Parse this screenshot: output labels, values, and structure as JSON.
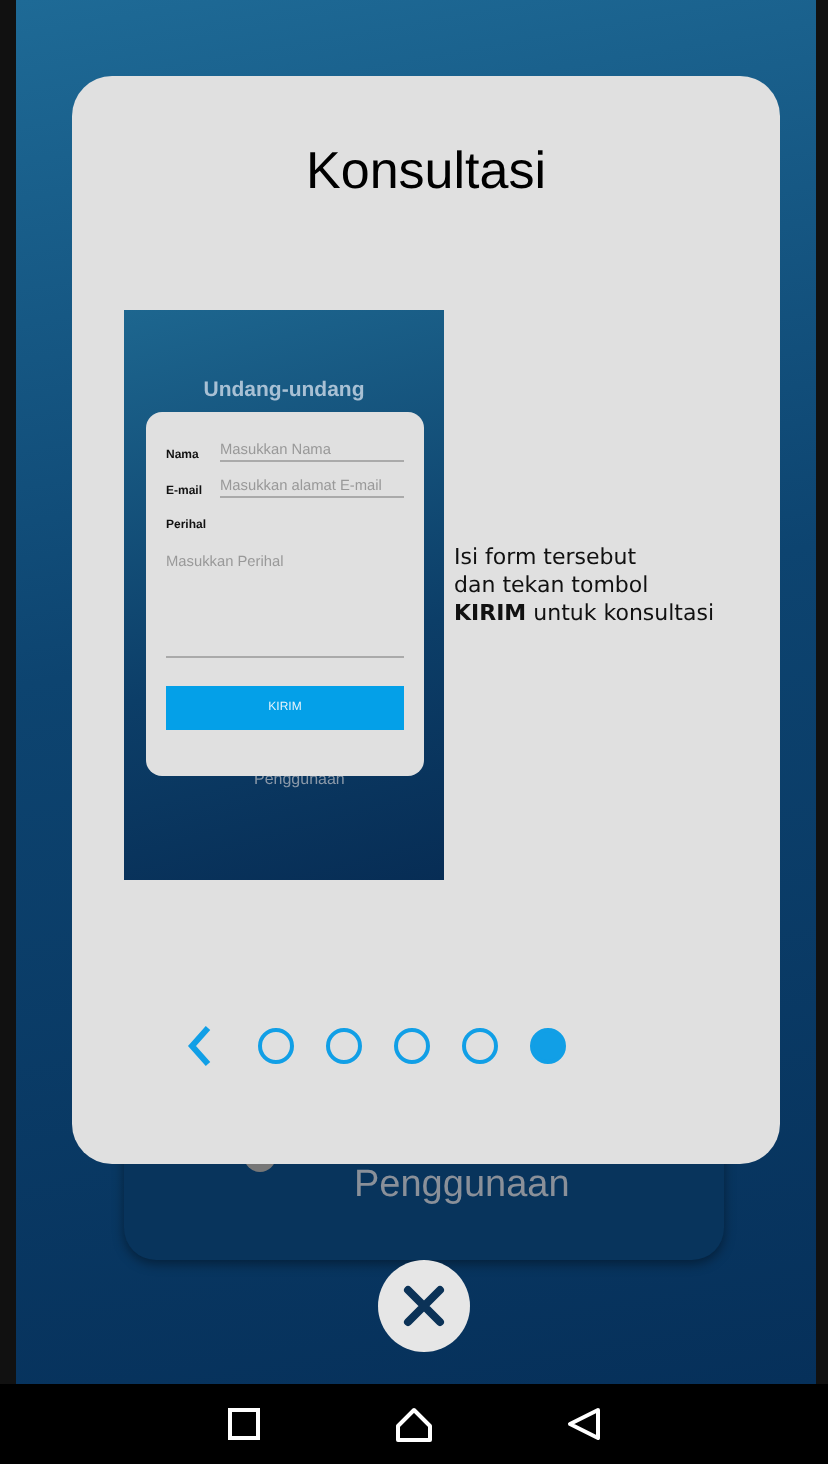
{
  "title": "Konsultasi",
  "preview": {
    "heading": "Undang-undang",
    "fields": [
      {
        "label": "Nama",
        "placeholder": "Masukkan Nama"
      },
      {
        "label": "E-mail",
        "placeholder": "Masukkan alamat E-mail"
      }
    ],
    "subject_label": "Perihal",
    "subject_placeholder": "Masukkan Perihal",
    "button": "KIRIM",
    "behind_label": "Penggunaan"
  },
  "instruction": "Isi form tersebut\ndan tekan tombol\n**KIRIM** untuk konsultasi",
  "pager": [
    {
      "selected": false
    },
    {
      "selected": false
    },
    {
      "selected": false
    },
    {
      "selected": false
    },
    {
      "selected": true
    }
  ],
  "background_card": {
    "label": "Penggunaan"
  }
}
